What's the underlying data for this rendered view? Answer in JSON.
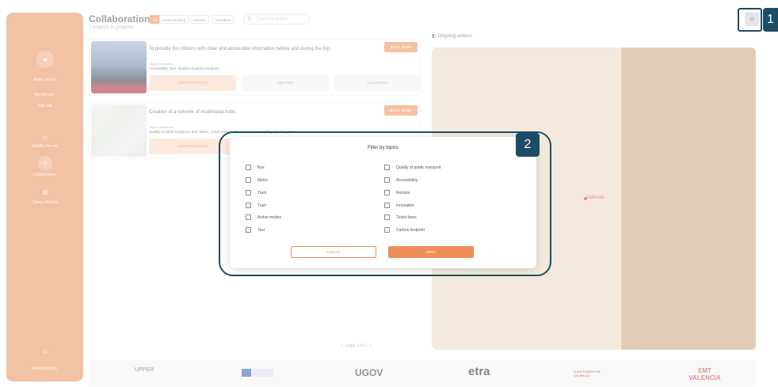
{
  "sidebar": {
    "greeting": "Hello, admin",
    "my_account": "My Account",
    "sign_out": "Sign out",
    "nav": [
      {
        "label": "Mobility Needs",
        "icon": "grid-icon"
      },
      {
        "label": "Collaboration",
        "icon": "share-icon"
      },
      {
        "label": "Citizen Wishes",
        "icon": "list-icon"
      }
    ],
    "admin_label": "Administration"
  },
  "header": {
    "title": "Collaboration",
    "subtitle": "2 projects in progress",
    "chips": [
      "All",
      "Understanding",
      "Ideation",
      "Validation"
    ],
    "search_placeholder": "Search by project"
  },
  "projects": [
    {
      "title": "To provide the citizens with clear and accessible information before and during the trip",
      "topics_label": "Topics of interest",
      "topics": "Accessibility, Bus, Quality of public transport",
      "see_details": "See details",
      "stages": [
        "UNDERSTANDING",
        "IDEATION",
        "VALIDATION"
      ]
    },
    {
      "title": "Creation of a network of multimodal hubs",
      "topics_label": "Topics of interest",
      "topics": "Quality of public transport, Bus, Metro, Active modes, Train, Taxi, Intermodality, Rentals, Tram",
      "see_details": "See details",
      "stages": [
        "UNDERSTANDING"
      ]
    }
  ],
  "map": {
    "label": "Ongoing actions",
    "city": "València"
  },
  "pagination": {
    "text": "page 1 of 1"
  },
  "footer": {
    "logos": [
      "UPPER",
      "UGOV",
      "etra",
      "AJUNTAMENT DE VALÈNCIA",
      "EMT VALENCIA"
    ]
  },
  "annotations": {
    "badge1": "1",
    "badge2": "2"
  },
  "modal": {
    "title": "Filter by topics",
    "left_options": [
      "Bus",
      "Metro",
      "Tram",
      "Train",
      "Active modes",
      "Taxi"
    ],
    "right_options": [
      "Quality of public transport",
      "Accessibility",
      "Rentals",
      "Innovation",
      "Ticket fares",
      "Carbon footprint"
    ],
    "cancel_label": "CANCEL",
    "apply_label": "APPLY"
  },
  "colors": {
    "accent": "#ef8d57",
    "sidebar": "#e8915a",
    "highlight": "#1d4d66"
  }
}
